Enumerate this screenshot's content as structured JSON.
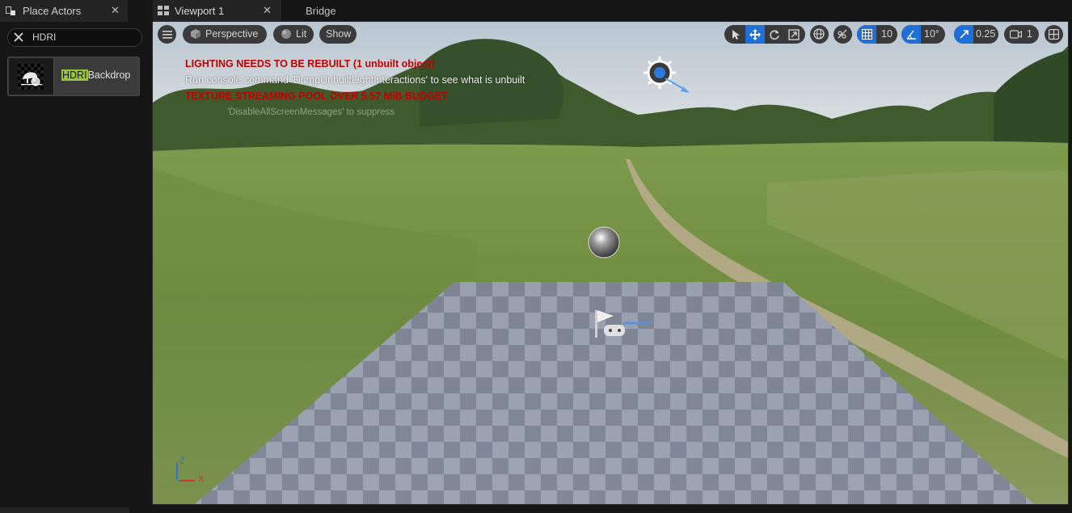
{
  "left_panel": {
    "tab_title": "Place Actors",
    "search_value": "HDRI",
    "result": {
      "highlight": "HDRI",
      "rest": "Backdrop"
    }
  },
  "tabs": {
    "viewport": "Viewport 1",
    "bridge": "Bridge"
  },
  "toolbar": {
    "view_mode": "Perspective",
    "lit_mode": "Lit",
    "show": "Show",
    "grid_snap": "10",
    "rotation_snap": "10°",
    "scale_snap": "0.25",
    "camera_speed": "1"
  },
  "messages": {
    "lighting": "LIGHTING NEEDS TO BE REBUILT (1 unbuilt object)",
    "console": "Run console command 'DumpUnbuiltLightInteractions' to see what is unbuilt",
    "texture": "TEXTURE STREAMING POOL OVER 5.57 MiB BUDGET",
    "suppress": "'DisableAllScreenMessages' to suppress"
  },
  "axis": {
    "z": "Z",
    "x": "X"
  },
  "colors": {
    "accent": "#1f6fd8",
    "warning": "#c10000",
    "search_highlight": "#95c43a"
  },
  "icons": {
    "place_actors": "place-actors-icon",
    "viewport": "viewport-layout-icon",
    "hamburger": "menu-icon",
    "cube": "perspective-cube-icon",
    "sphere": "lit-sphere-icon"
  }
}
